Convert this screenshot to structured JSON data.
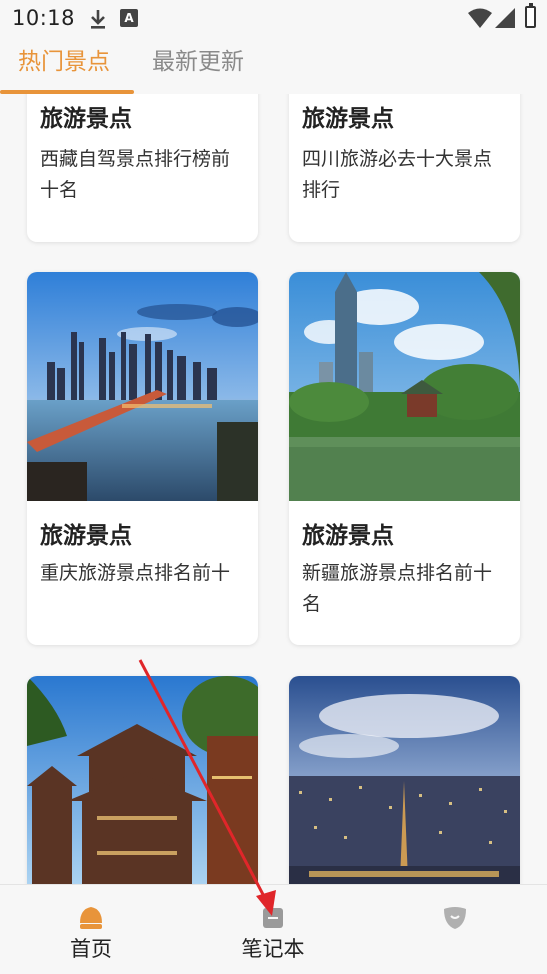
{
  "status": {
    "time": "10:18",
    "notification_letter": "A",
    "icons": [
      "download-icon",
      "a-notification-icon",
      "wifi-icon",
      "signal-icon",
      "battery-icon"
    ]
  },
  "tabs": [
    {
      "label": "热门景点",
      "active": true
    },
    {
      "label": "最新更新",
      "active": false
    }
  ],
  "accent_color": "#e8943a",
  "cards": [
    {
      "title": "旅游景点",
      "desc": "西藏自驾景点排行榜前十名"
    },
    {
      "title": "旅游景点",
      "desc": "四川旅游必去十大景点排行"
    },
    {
      "title": "旅游景点",
      "desc": "重庆旅游景点排名前十"
    },
    {
      "title": "旅游景点",
      "desc": "新疆旅游景点排名前十名"
    },
    {
      "title": "",
      "desc": ""
    },
    {
      "title": "",
      "desc": ""
    }
  ],
  "bottom_nav": [
    {
      "label": "首页",
      "icon": "home-icon",
      "active": true
    },
    {
      "label": "笔记本",
      "icon": "notebook-icon",
      "active": false
    },
    {
      "label": "",
      "icon": "profile-icon",
      "active": false
    }
  ]
}
